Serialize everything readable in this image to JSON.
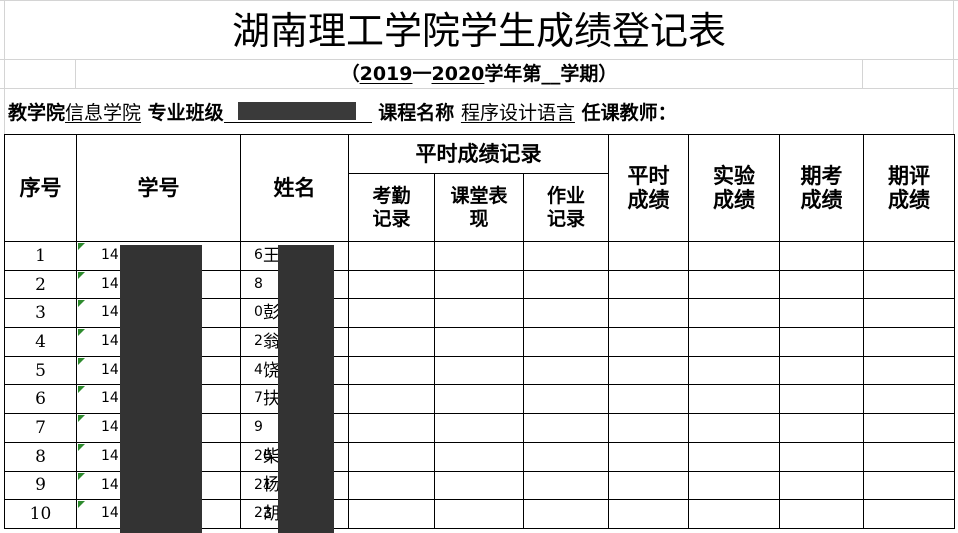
{
  "title": "湖南理工学院学生成绩登记表",
  "subtitle": {
    "open": "（",
    "year_start": "2019",
    "dash": "一",
    "year_end": "2020",
    "mid": "学年第",
    "term_blank": "__",
    "close": "学期）"
  },
  "info": {
    "college_label": "教学院",
    "college_value": "信息学院",
    "class_label": "专业班级",
    "course_label": "课程名称",
    "course_value": "程序设计语言",
    "teacher_label": "任课教师："
  },
  "headers": {
    "index": "序号",
    "student_id": "学号",
    "name": "姓名",
    "daily_group": "平时成绩记录",
    "attendance": [
      "考勤",
      "记录"
    ],
    "class_performance": [
      "课堂表",
      "现"
    ],
    "homework": [
      "作业",
      "记录"
    ],
    "daily_score": [
      "平时",
      "成绩"
    ],
    "lab_score": [
      "实验",
      "成绩"
    ],
    "exam_score": [
      "期考",
      "成绩"
    ],
    "final_score": [
      "期评",
      "成绩"
    ]
  },
  "rows": [
    {
      "index": "1",
      "id_prefix": "14",
      "id_suffix": "6",
      "name_char": "王"
    },
    {
      "index": "2",
      "id_prefix": "14",
      "id_suffix": "8",
      "name_char": ""
    },
    {
      "index": "3",
      "id_prefix": "14",
      "id_suffix": "0",
      "name_char": "彭"
    },
    {
      "index": "4",
      "id_prefix": "14",
      "id_suffix": "2",
      "name_char": "翁"
    },
    {
      "index": "5",
      "id_prefix": "14",
      "id_suffix": "4",
      "name_char": "饶"
    },
    {
      "index": "6",
      "id_prefix": "14",
      "id_suffix": "7",
      "name_char": "扶"
    },
    {
      "index": "7",
      "id_prefix": "14",
      "id_suffix": "9",
      "name_char": ""
    },
    {
      "index": "8",
      "id_prefix": "14",
      "id_suffix": "20",
      "name_char": "柴"
    },
    {
      "index": "9",
      "id_prefix": "14",
      "id_suffix": "21",
      "name_char": "杨"
    },
    {
      "index": "10",
      "id_prefix": "14",
      "id_suffix": "23",
      "name_char": "胡"
    }
  ]
}
